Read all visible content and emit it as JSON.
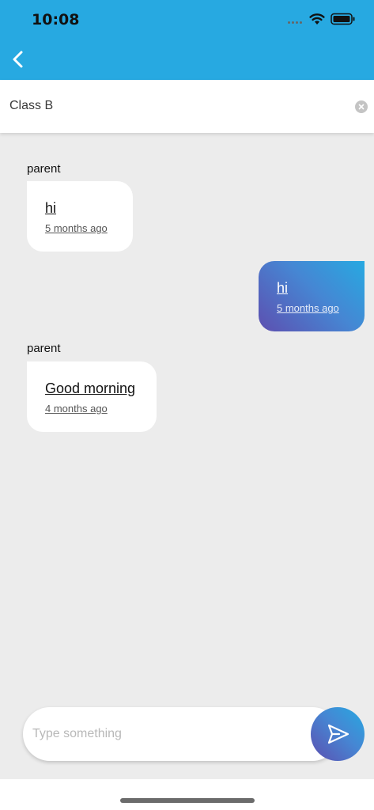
{
  "status_bar": {
    "time": "10:08"
  },
  "header": {
    "back_icon": "chevron-left-icon",
    "background_color": "#27a9e1"
  },
  "conversation": {
    "title": "Class B",
    "clear_icon": "clear-circle-icon"
  },
  "messages": [
    {
      "sender": "parent",
      "text": "hi",
      "time": "5 months ago",
      "direction": "incoming"
    },
    {
      "sender": "",
      "text": "hi",
      "time": "5 months ago",
      "direction": "outgoing"
    },
    {
      "sender": "parent",
      "text": "Good morning",
      "time": "4 months ago",
      "direction": "incoming"
    }
  ],
  "composer": {
    "placeholder": "Type something",
    "value": "",
    "send_icon": "send-icon"
  },
  "colors": {
    "accent": "#27a9e1",
    "gradient_start": "#5d4fb0",
    "background": "#ececec"
  }
}
